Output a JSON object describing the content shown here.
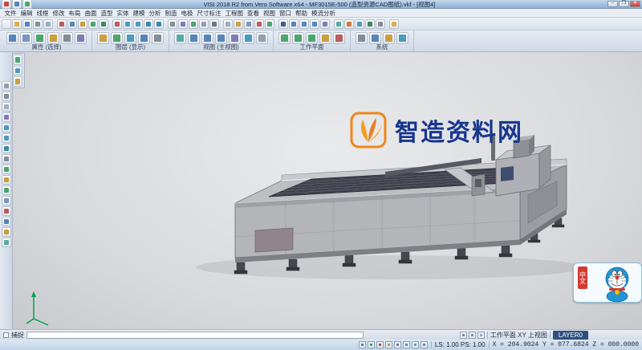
{
  "window": {
    "title": "VISI 2018 R2 from Vero Software x64  -  MF3015E-500 (造型资源CAD图纸).vkf - [视图4]",
    "minimize": "–",
    "maximize": "❐",
    "close": "✕",
    "quick_icons": [
      {
        "n": "app-logo",
        "c": "#c23b2e"
      },
      {
        "n": "quick-save",
        "c": "#4a7ab5"
      },
      {
        "n": "quick-undo",
        "c": "#3f9e5f"
      }
    ]
  },
  "menubar": {
    "items": [
      "文件",
      "编辑",
      "线框",
      "修改",
      "布局",
      "曲面",
      "造型",
      "实体",
      "建模",
      "分析",
      "制造",
      "电极",
      "尺寸标注",
      "工程图",
      "查看",
      "视图",
      "窗口",
      "帮助",
      "模流分析"
    ]
  },
  "toolbar1": {
    "icons": [
      {
        "n": "new-file",
        "c": "#e8edf4"
      },
      {
        "n": "open-file",
        "c": "#d9a93c"
      },
      {
        "n": "save-file",
        "c": "#4a7ab5"
      },
      {
        "n": "print",
        "c": "#7d828c"
      },
      {
        "n": "print-preview",
        "c": "#91a6c4"
      },
      {
        "n": "cut",
        "c": "#b44f4f"
      },
      {
        "n": "copy",
        "c": "#4a7ab5"
      },
      {
        "n": "paste",
        "c": "#c9972f"
      },
      {
        "n": "undo",
        "c": "#3f9e5f"
      },
      {
        "n": "redo",
        "c": "#2f7e4f"
      },
      {
        "n": "delete",
        "c": "#b44f4f"
      },
      {
        "n": "zoom-in",
        "c": "#3f93b8"
      },
      {
        "n": "zoom-out",
        "c": "#3f93b8"
      },
      {
        "n": "zoom-window",
        "c": "#2f7ea0"
      },
      {
        "n": "zoom-fit",
        "c": "#2f7ea0"
      },
      {
        "n": "pan",
        "c": "#7d828c"
      },
      {
        "n": "rotate-view",
        "c": "#7a6fb0"
      },
      {
        "n": "refresh",
        "c": "#3f9e5f"
      },
      {
        "n": "shaded-view",
        "c": "#8a97a8"
      },
      {
        "n": "wireframe-view",
        "c": "#5f6a78"
      },
      {
        "n": "hidden-line",
        "c": "#9aa5b4"
      },
      {
        "n": "layer-manager",
        "c": "#c9972f"
      },
      {
        "n": "grid-toggle",
        "c": "#6f8fb8"
      },
      {
        "n": "snap-toggle",
        "c": "#b44f4f"
      },
      {
        "n": "workplane",
        "c": "#3f9e5f"
      },
      {
        "n": "point-tool",
        "c": "#2f4f7f"
      },
      {
        "n": "line-tool",
        "c": "#4a7ab5"
      },
      {
        "n": "arc-tool",
        "c": "#4a7ab5"
      },
      {
        "n": "circle-tool",
        "c": "#4a7ab5"
      },
      {
        "n": "curve-tool",
        "c": "#7a6fb0"
      },
      {
        "n": "surface-tool",
        "c": "#4aa59a"
      },
      {
        "n": "solid-tool",
        "c": "#c96f2f"
      },
      {
        "n": "measure-tool",
        "c": "#3f93b8"
      },
      {
        "n": "dimension-tool",
        "c": "#2f7e4f"
      },
      {
        "n": "calculator",
        "c": "#7d828c"
      },
      {
        "n": "help",
        "c": "#d9a93c"
      }
    ]
  },
  "ribbon": {
    "g1": {
      "label": "属性 (选择)",
      "icons": [
        {
          "n": "select-arrow",
          "c": "#4a7ab5"
        },
        {
          "n": "select-window",
          "c": "#6f8fb8"
        },
        {
          "n": "select-chain",
          "c": "#3f9e5f"
        },
        {
          "n": "select-color",
          "c": "#c9972f"
        },
        {
          "n": "properties",
          "c": "#7d828c"
        },
        {
          "n": "match-properties",
          "c": "#7a6fb0"
        }
      ]
    },
    "g2": {
      "label": "图层 (显示)",
      "icons": [
        {
          "n": "layer-list",
          "c": "#c9972f"
        },
        {
          "n": "layer-visibility",
          "c": "#3f9e5f"
        },
        {
          "n": "layer-freeze",
          "c": "#3f93b8"
        },
        {
          "n": "layer-new",
          "c": "#4a7ab5"
        },
        {
          "n": "layer-filter",
          "c": "#7d828c"
        }
      ]
    },
    "g3": {
      "label": "视图 (主视图)",
      "icons": [
        {
          "n": "view-iso",
          "c": "#4aa59a"
        },
        {
          "n": "view-top",
          "c": "#4a7ab5"
        },
        {
          "n": "view-front",
          "c": "#4a7ab5"
        },
        {
          "n": "view-side",
          "c": "#4a7ab5"
        },
        {
          "n": "view-rotate",
          "c": "#7a6fb0"
        },
        {
          "n": "view-zoom-fit",
          "c": "#3f93b8"
        },
        {
          "n": "view-shade",
          "c": "#8a97a8"
        }
      ]
    },
    "g4": {
      "label": "工作平面",
      "icons": [
        {
          "n": "workplane-xy",
          "c": "#3f9e5f"
        },
        {
          "n": "workplane-xz",
          "c": "#3f9e5f"
        },
        {
          "n": "workplane-yz",
          "c": "#3f9e5f"
        },
        {
          "n": "workplane-3point",
          "c": "#c9972f"
        },
        {
          "n": "workplane-reset",
          "c": "#b44f4f"
        }
      ]
    },
    "g5": {
      "label": "系统",
      "icons": [
        {
          "n": "system-settings",
          "c": "#7d828c"
        },
        {
          "n": "system-database",
          "c": "#4a7ab5"
        },
        {
          "n": "system-macro",
          "c": "#c9972f"
        },
        {
          "n": "system-info",
          "c": "#3f93b8"
        }
      ]
    }
  },
  "palette": {
    "icons": [
      {
        "n": "pick-point",
        "c": "#3f9e5f"
      },
      {
        "n": "pick-line",
        "c": "#3f9e5f"
      },
      {
        "n": "pick-face",
        "c": "#4aa59a"
      },
      {
        "n": "pick-solid",
        "c": "#3f93b8"
      },
      {
        "n": "pick-window",
        "c": "#6f8fb8"
      },
      {
        "n": "pick-all",
        "c": "#c9972f"
      }
    ]
  },
  "left_rail": {
    "icons": [
      {
        "n": "shade-mode",
        "c": "#8a97a8"
      },
      {
        "n": "wireframe-mode",
        "c": "#7d828c"
      },
      {
        "n": "hidden-line-mode",
        "c": "#9aa5b4"
      },
      {
        "n": "rotate-3d",
        "c": "#7a6fb0"
      },
      {
        "n": "rail-zoom-in",
        "c": "#3f93b8"
      },
      {
        "n": "rail-zoom-out",
        "c": "#3f93b8"
      },
      {
        "n": "rail-zoom-all",
        "c": "#2f7ea0"
      },
      {
        "n": "rail-pan",
        "c": "#7d828c"
      },
      {
        "n": "previous-view",
        "c": "#3f9e5f"
      },
      {
        "n": "layers-panel",
        "c": "#c9972f"
      },
      {
        "n": "workplane-toggle",
        "c": "#3f9e5f"
      },
      {
        "n": "grid",
        "c": "#6f8fb8"
      },
      {
        "n": "snap",
        "c": "#b44f4f"
      },
      {
        "n": "measure",
        "c": "#4a7ab5"
      },
      {
        "n": "annotate",
        "c": "#c9972f"
      },
      {
        "n": "render",
        "c": "#4aa59a"
      }
    ]
  },
  "viewport": {
    "watermark_text": "智造资料网",
    "sticker_badge": "中文"
  },
  "statusbar": {
    "snap_label": "捕捉",
    "view_label": "工作平面 XY 上视图",
    "layer_badge": "LAYER0",
    "scale_label": "LS: 1.00  PS: 1.00",
    "coords": "X = 204.9024   Y = 077.6824   Z = 000.0000",
    "icons_row1": [
      {
        "n": "ortho-toggle",
        "c": "#7d828c"
      },
      {
        "n": "polar-toggle",
        "c": "#6f8fb8"
      },
      {
        "n": "track-toggle",
        "c": "#91a6c4"
      }
    ],
    "icons_row2": [
      {
        "n": "snap-endpoint",
        "c": "#4a7ab5"
      },
      {
        "n": "snap-midpoint",
        "c": "#3f9e5f"
      },
      {
        "n": "snap-center",
        "c": "#b44f4f"
      },
      {
        "n": "snap-quadrant",
        "c": "#c9972f"
      },
      {
        "n": "snap-intersection",
        "c": "#7a6fb0"
      },
      {
        "n": "snap-perpendicular",
        "c": "#3f93b8"
      },
      {
        "n": "snap-tangent",
        "c": "#4aa59a"
      },
      {
        "n": "snap-grid",
        "c": "#7d828c"
      }
    ]
  },
  "colors": {
    "accent_blue": "#2f4f7f",
    "watermark_orange": "#f08519",
    "watermark_blue": "#17368e",
    "badge_red": "#d23b2f",
    "machine_body": "#b3b5b9",
    "machine_bed": "#3e414b"
  }
}
